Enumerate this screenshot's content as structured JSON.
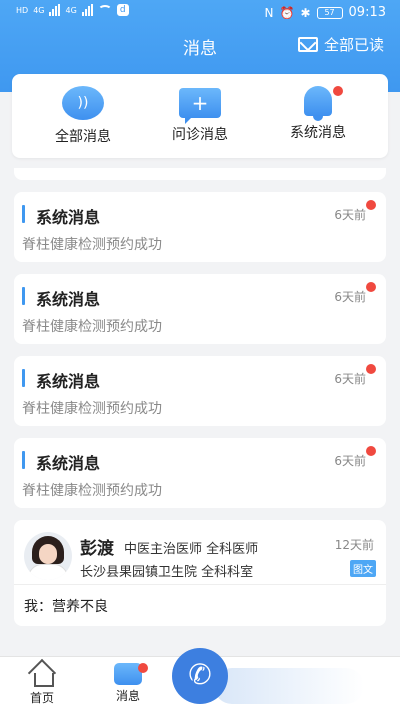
{
  "status_bar": {
    "left_chip": "HD",
    "net": "4G",
    "net2": "4G",
    "app_badge": "d",
    "battery": "57",
    "time": "09:13"
  },
  "header": {
    "title": "消息",
    "read_all": "全部已读"
  },
  "categories": [
    {
      "label": "全部消息",
      "icon": "speaker-icon",
      "glyph": "))"
    },
    {
      "label": "问诊消息",
      "icon": "chat-plus-icon",
      "glyph": "+"
    },
    {
      "label": "系统消息",
      "icon": "bell-icon",
      "glyph": ""
    }
  ],
  "messages": [
    {
      "title": "系统消息",
      "time": "6天前",
      "desc": "脊柱健康检测预约成功"
    },
    {
      "title": "系统消息",
      "time": "6天前",
      "desc": "脊柱健康检测预约成功"
    },
    {
      "title": "系统消息",
      "time": "6天前",
      "desc": "脊柱健康检测预约成功"
    },
    {
      "title": "系统消息",
      "time": "6天前",
      "desc": "脊柱健康检测预约成功"
    }
  ],
  "doctor_message": {
    "name": "彭渡",
    "title": "中医主治医师  全科医师",
    "time": "12天前",
    "hospital": "长沙县果园镇卫生院  全科科室",
    "tag": "图文",
    "message": "我：营养不良"
  },
  "tabbar": {
    "home": "首页",
    "messages": "消息",
    "fab_icon": "phone-icon"
  },
  "colors": {
    "accent": "#3f98f0",
    "badge": "#f0493f"
  }
}
